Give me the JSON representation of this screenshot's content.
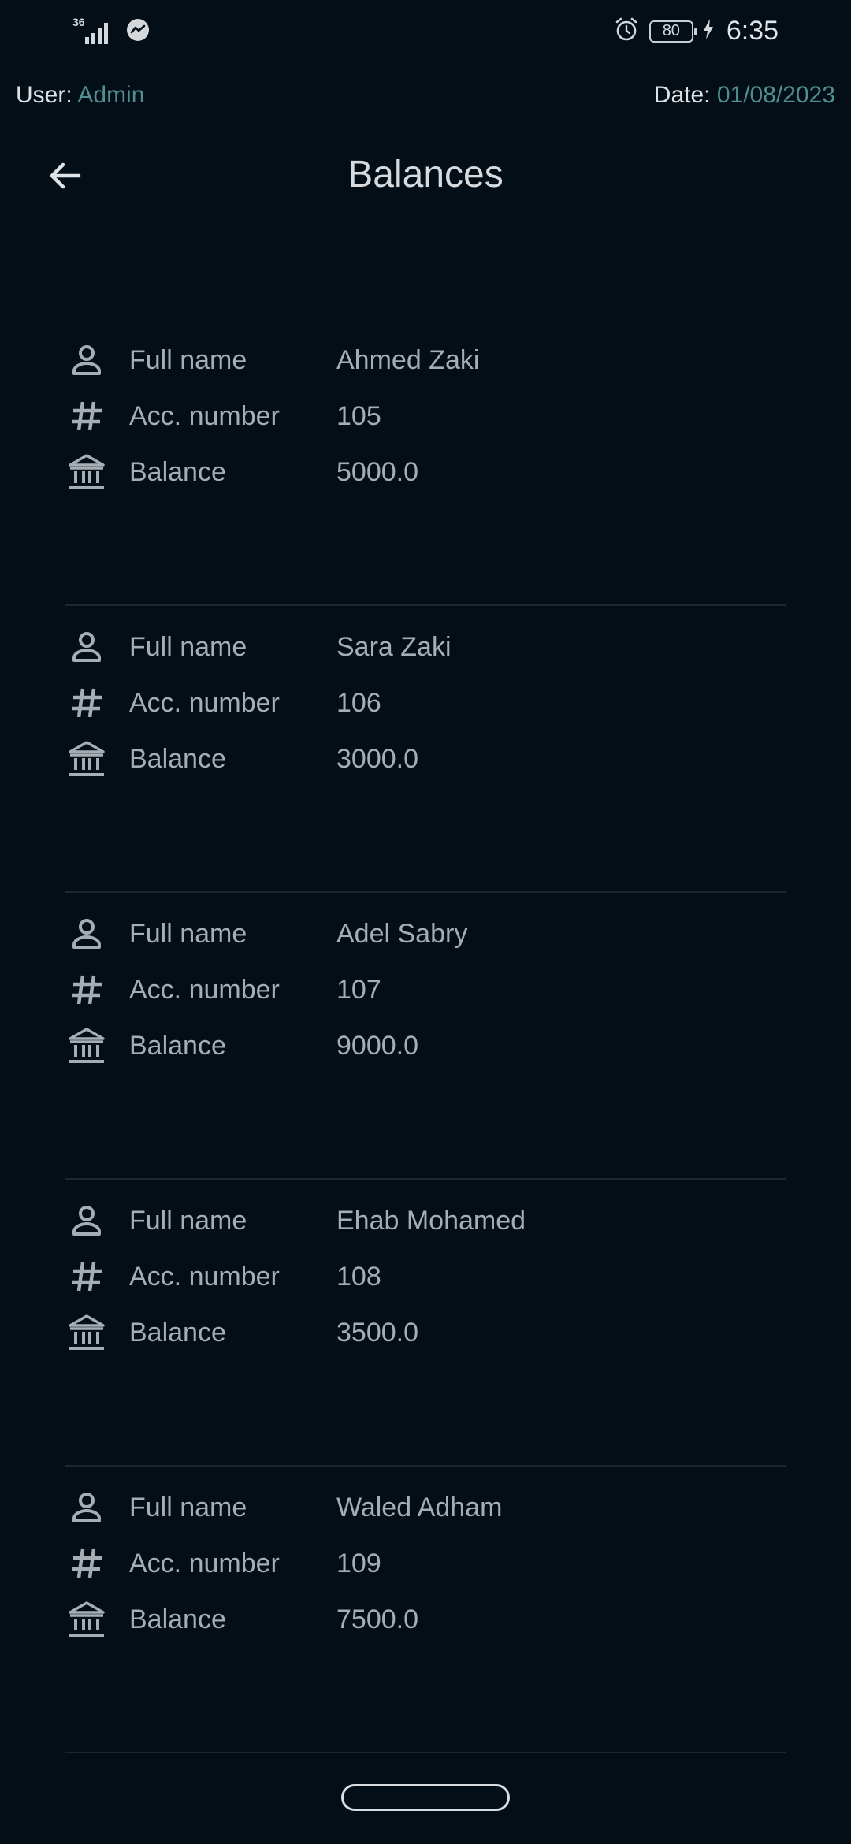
{
  "status_bar": {
    "network_type": "36",
    "battery_level": "80",
    "time": "6:35",
    "icons": [
      "signal-icon",
      "messenger-icon",
      "alarm-icon",
      "battery-icon",
      "charging-icon"
    ]
  },
  "info": {
    "user_label": "User:",
    "user_value": "Admin",
    "date_label": "Date:",
    "date_value": "01/08/2023"
  },
  "app_bar": {
    "title": "Balances",
    "back_icon": "arrow-back-icon"
  },
  "field_labels": {
    "full_name": "Full name",
    "account_number": "Acc. number",
    "balance": "Balance"
  },
  "field_icons": {
    "full_name": "person-icon",
    "account_number": "hash-icon",
    "balance": "bank-icon"
  },
  "accounts": [
    {
      "full_name": "Ahmed Zaki",
      "account_number": "105",
      "balance": "5000.0"
    },
    {
      "full_name": "Sara Zaki",
      "account_number": "106",
      "balance": "3000.0"
    },
    {
      "full_name": "Adel Sabry",
      "account_number": "107",
      "balance": "9000.0"
    },
    {
      "full_name": "Ehab Mohamed",
      "account_number": "108",
      "balance": "3500.0"
    },
    {
      "full_name": "Waled Adham",
      "account_number": "109",
      "balance": "7500.0"
    }
  ],
  "colors": {
    "background": "#040e17",
    "accent": "#4f8f8d",
    "text_primary": "#d7dbde",
    "text_secondary": "#a6adb3",
    "divider": "#1c2831"
  }
}
